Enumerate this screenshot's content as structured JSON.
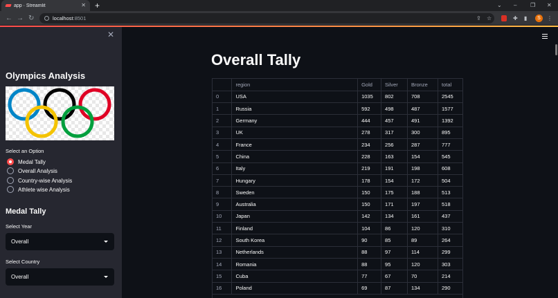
{
  "browser": {
    "tab_title": "app · Streamlit",
    "url_host": "localhost",
    "url_port": ":8501",
    "avatar_letter": "S"
  },
  "sidebar": {
    "title": "Olympics Analysis",
    "select_option_label": "Select an Option",
    "options": [
      "Medal Tally",
      "Overall Analysis",
      "Country-wise Analysis",
      "Athlete wise Analysis"
    ],
    "selected_option": "Medal Tally",
    "section_title": "Medal Tally",
    "select_year_label": "Select Year",
    "select_year_value": "Overall",
    "select_country_label": "Select Country",
    "select_country_value": "Overall"
  },
  "main": {
    "title": "Overall Tally",
    "table": {
      "columns": [
        "",
        "region",
        "Gold",
        "Silver",
        "Bronze",
        "total"
      ],
      "rows": [
        [
          "0",
          "USA",
          "1035",
          "802",
          "708",
          "2545"
        ],
        [
          "1",
          "Russia",
          "592",
          "498",
          "487",
          "1577"
        ],
        [
          "2",
          "Germany",
          "444",
          "457",
          "491",
          "1392"
        ],
        [
          "3",
          "UK",
          "278",
          "317",
          "300",
          "895"
        ],
        [
          "4",
          "France",
          "234",
          "256",
          "287",
          "777"
        ],
        [
          "5",
          "China",
          "228",
          "163",
          "154",
          "545"
        ],
        [
          "6",
          "Italy",
          "219",
          "191",
          "198",
          "608"
        ],
        [
          "7",
          "Hungary",
          "178",
          "154",
          "172",
          "504"
        ],
        [
          "8",
          "Sweden",
          "150",
          "175",
          "188",
          "513"
        ],
        [
          "9",
          "Australia",
          "150",
          "171",
          "197",
          "518"
        ],
        [
          "10",
          "Japan",
          "142",
          "134",
          "161",
          "437"
        ],
        [
          "11",
          "Finland",
          "104",
          "86",
          "120",
          "310"
        ],
        [
          "12",
          "South Korea",
          "90",
          "85",
          "89",
          "264"
        ],
        [
          "13",
          "Netherlands",
          "88",
          "97",
          "114",
          "299"
        ],
        [
          "14",
          "Romania",
          "88",
          "95",
          "120",
          "303"
        ],
        [
          "15",
          "Cuba",
          "77",
          "67",
          "70",
          "214"
        ],
        [
          "16",
          "Poland",
          "69",
          "87",
          "134",
          "290"
        ]
      ]
    }
  },
  "colors": {
    "accent": "#ff4b4b",
    "sidebar_bg": "#262730",
    "main_bg": "#0e1117",
    "text": "#fafafa"
  }
}
